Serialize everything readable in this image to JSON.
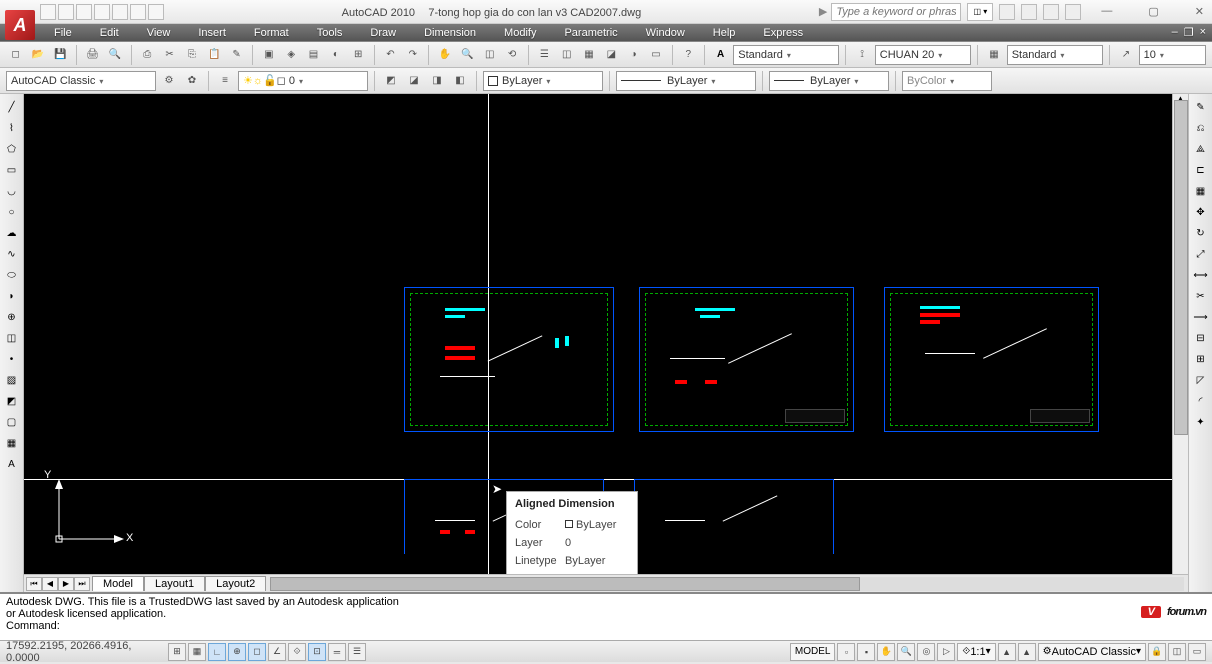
{
  "title": {
    "app": "AutoCAD 2010",
    "file": "7-tong hop gia do con lan v3 CAD2007.dwg"
  },
  "search_placeholder": "Type a keyword or phrase",
  "win_controls": {
    "min": "—",
    "max": "▢",
    "close": "✕"
  },
  "menu": [
    "File",
    "Edit",
    "View",
    "Insert",
    "Format",
    "Tools",
    "Draw",
    "Dimension",
    "Modify",
    "Parametric",
    "Window",
    "Help",
    "Express"
  ],
  "mdi": {
    "min": "–",
    "max": "❐",
    "close": "×"
  },
  "toolbar1": {
    "text_style": "Standard",
    "dim_style": "CHUAN 20",
    "table_style": "Standard",
    "mleader": "10"
  },
  "toolbar2": {
    "workspace": "AutoCAD Classic",
    "layer_combo": "0",
    "color": "ByLayer",
    "linetype": "ByLayer",
    "lineweight": "ByLayer",
    "plot_style": "ByColor"
  },
  "tooltip": {
    "title": "Aligned Dimension",
    "color_lbl": "Color",
    "color_val": "ByLayer",
    "layer_lbl": "Layer",
    "layer_val": "0",
    "ltype_lbl": "Linetype",
    "ltype_val": "ByLayer"
  },
  "tabs": {
    "model": "Model",
    "l1": "Layout1",
    "l2": "Layout2"
  },
  "cmd": {
    "l1": "Autodesk DWG.  This file is a TrustedDWG last saved by an Autodesk application",
    "l2": "or Autodesk licensed application.",
    "l3": "Command:"
  },
  "status": {
    "coords": "17592.2195, 20266.4916, 0.0000",
    "model": "MODEL",
    "scale": "1:1",
    "ws": "AutoCAD Classic"
  },
  "ucs": {
    "x": "X",
    "y": "Y"
  },
  "watermark": "forum.vn"
}
